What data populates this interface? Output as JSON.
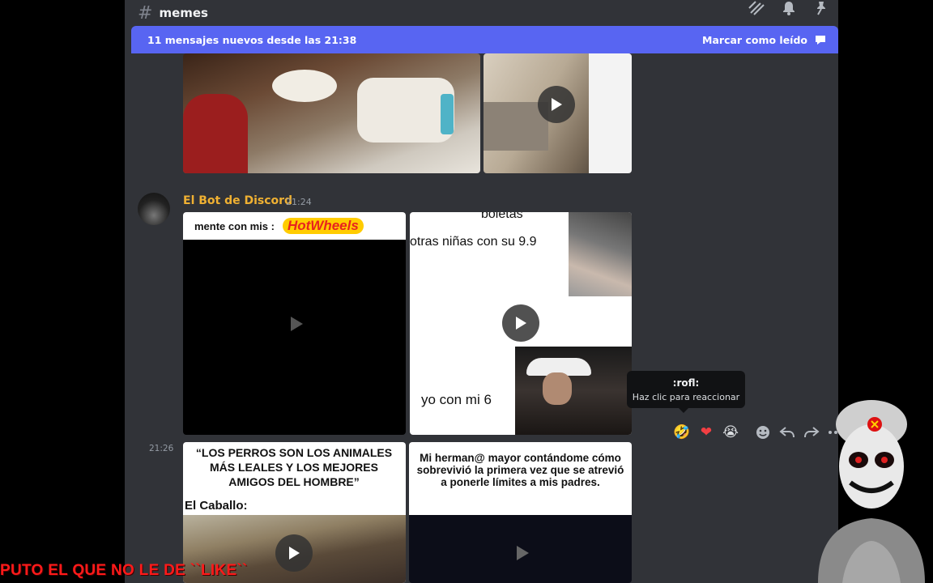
{
  "channel": {
    "name": "memes"
  },
  "new_messages": {
    "text": "11 mensajes nuevos desde las 21:38",
    "action": "Marcar como leído"
  },
  "message": {
    "author": "El Bot de Discord",
    "time": "21:24",
    "followup_time": "21:26"
  },
  "memes": {
    "hotwheels_caption": "mente con mis :",
    "hotwheels_logo": "HotWheels",
    "boletas_top": "boletas",
    "boletas_line": "otras niñas con su 9.9",
    "boletas_bottom": "yo con mi 6",
    "perros_caption": "“LOS PERROS SON LOS ANIMALES MÁS LEALES Y LOS MEJORES AMIGOS DEL HOMBRE”",
    "perros_sub": "El Caballo:",
    "hermano_caption": "Mi herman@ mayor contándome cómo sobrevivió la primera vez que se atrevió a ponerle límites a mis padres."
  },
  "tooltip": {
    "title": ":rofl:",
    "subtitle": "Haz clic para reaccionar"
  },
  "overlay": {
    "watermark": "PUTO EL QUE NO LE DE ``LIKE``"
  },
  "colors": {
    "accent": "#5865f2",
    "author": "#f0b132",
    "bg": "#313338"
  },
  "icons": [
    "hash-icon",
    "threads-icon",
    "bell-icon",
    "pin-icon",
    "mark-read-icon",
    "play-icon",
    "rofl-emoji-icon",
    "heart-emoji-icon",
    "sob-emoji-icon",
    "add-reaction-icon",
    "reply-icon",
    "forward-icon",
    "more-icon"
  ]
}
